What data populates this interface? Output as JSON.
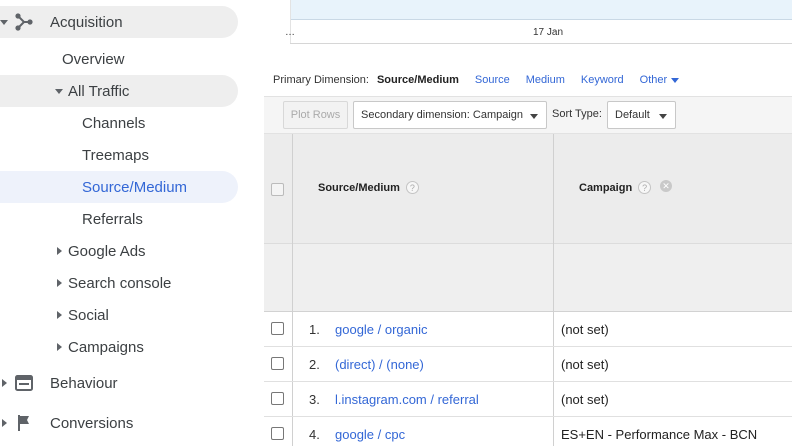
{
  "sidebar": {
    "section": {
      "label": "Acquisition",
      "icon": "acquisition-icon"
    },
    "overview": "Overview",
    "all_traffic": "All Traffic",
    "sub_items": [
      "Channels",
      "Treemaps",
      "Source/Medium",
      "Referrals"
    ],
    "active_item": "Source/Medium",
    "groups": [
      "Google Ads",
      "Search console",
      "Social",
      "Campaigns"
    ],
    "behaviour": {
      "label": "Behaviour",
      "icon": "behaviour-icon"
    },
    "conversions": {
      "label": "Conversions",
      "icon": "flag-icon"
    }
  },
  "chart": {
    "axis_left": "…",
    "axis_center": "17 Jan"
  },
  "primary_dimension": {
    "label": "Primary Dimension:",
    "current": "Source/Medium",
    "links": [
      "Source",
      "Medium",
      "Keyword"
    ],
    "other": "Other"
  },
  "toolbar": {
    "plot_rows": "Plot Rows",
    "secondary_dimension": "Secondary dimension: Campaign",
    "sort_type_label": "Sort Type:",
    "sort_type_value": "Default"
  },
  "table": {
    "columns": [
      "Source/Medium",
      "Campaign"
    ],
    "rows": [
      {
        "num": "1.",
        "source": "google / organic",
        "campaign": "(not set)"
      },
      {
        "num": "2.",
        "source": "(direct) / (none)",
        "campaign": "(not set)"
      },
      {
        "num": "3.",
        "source": "l.instagram.com / referral",
        "campaign": "(not set)"
      },
      {
        "num": "4.",
        "source": "google / cpc",
        "campaign": "ES+EN - Performance Max - BCN"
      }
    ]
  },
  "colors": {
    "link": "#3367d6",
    "active_bg": "#eef2fb",
    "chart_fill": "#e8f3fb"
  }
}
